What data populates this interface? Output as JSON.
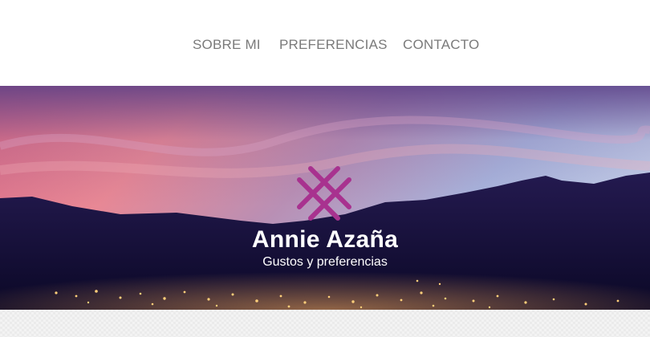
{
  "nav": {
    "items": [
      {
        "label": "SOBRE MI"
      },
      {
        "label": "PREFERENCIAS"
      },
      {
        "label": "CONTACTO"
      }
    ]
  },
  "hero": {
    "title": "Annie Azaña",
    "subtitle": "Gustos y preferencias",
    "background": "sunset-mountains-city-lights",
    "logo_icon": "crossed-lines-logo-icon"
  },
  "colors": {
    "nav_text": "#7a7a7a",
    "logo": "#a8328f",
    "mountains": "#14103a",
    "hero_text": "#ffffff",
    "pattern": "#f3f3f3"
  }
}
